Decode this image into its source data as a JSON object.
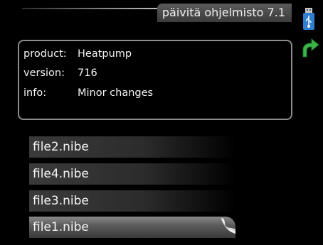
{
  "header": {
    "title": "päivitä ohjelmisto 7.1",
    "usb_icon": "usb-icon",
    "back_icon": "green-arrow-back-icon"
  },
  "info": {
    "rows": [
      {
        "key": "product:",
        "value": "Heatpump"
      },
      {
        "key": "version:",
        "value": "716"
      },
      {
        "key": "info:",
        "value": "Minor changes"
      }
    ]
  },
  "files": [
    {
      "label": "file2.nibe",
      "selected": false
    },
    {
      "label": "file4.nibe",
      "selected": false
    },
    {
      "label": "file3.nibe",
      "selected": false
    },
    {
      "label": "file1.nibe",
      "selected": true
    }
  ],
  "colors": {
    "background": "#000000",
    "accent_green": "#3cb44a",
    "usb_blue": "#2f7fd0"
  }
}
